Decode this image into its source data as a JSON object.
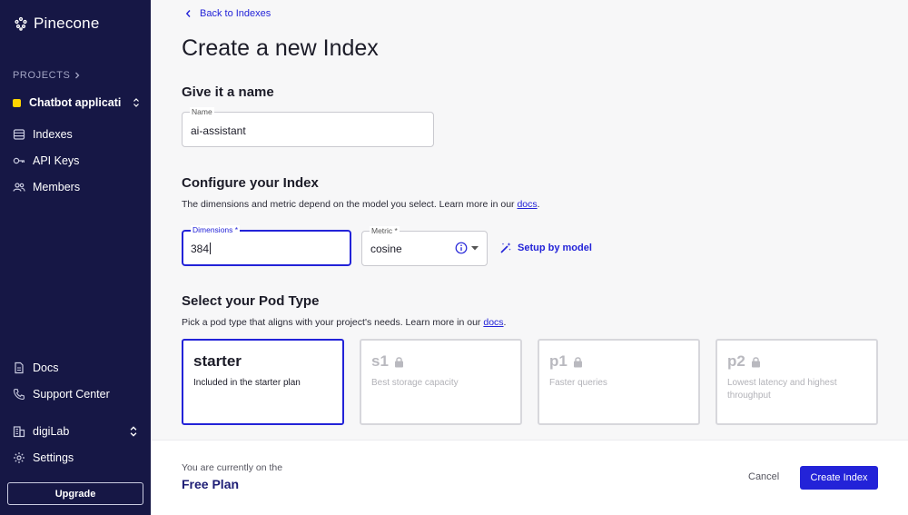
{
  "sidebar": {
    "brand": "Pinecone",
    "projects_label": "PROJECTS",
    "project_name": "Chatbot applicati...",
    "nav": {
      "indexes": "Indexes",
      "api_keys": "API Keys",
      "members": "Members",
      "docs": "Docs",
      "support": "Support Center",
      "org": "digiLab",
      "settings": "Settings"
    },
    "upgrade_label": "Upgrade"
  },
  "header": {
    "back_label": "Back to Indexes",
    "title": "Create a new Index"
  },
  "name_section": {
    "title": "Give it a name",
    "name_label": "Name",
    "name_value": "ai-assistant"
  },
  "config_section": {
    "title": "Configure your Index",
    "description": "The dimensions and metric depend on the model you select. Learn more in our",
    "docs_link": "docs",
    "period": ".",
    "dimensions_label": "Dimensions *",
    "dimensions_value": "384",
    "metric_label": "Metric *",
    "metric_value": "cosine",
    "setup_label": "Setup by model"
  },
  "pod_section": {
    "title": "Select your Pod Type",
    "description": "Pick a pod type that aligns with your project's needs. Learn more in our",
    "docs_link": "docs",
    "period": ".",
    "pods": [
      {
        "name": "starter",
        "desc": "Included in the starter plan"
      },
      {
        "name": "s1",
        "desc": "Best storage capacity"
      },
      {
        "name": "p1",
        "desc": "Faster queries"
      },
      {
        "name": "p2",
        "desc": "Lowest latency and highest throughput"
      }
    ]
  },
  "footer": {
    "note": "You are currently on the",
    "plan": "Free Plan",
    "cancel_label": "Cancel",
    "create_label": "Create Index"
  },
  "colors": {
    "sidebar_bg": "#161745",
    "accent": "#2323d8",
    "project_dot": "#ffd400"
  }
}
